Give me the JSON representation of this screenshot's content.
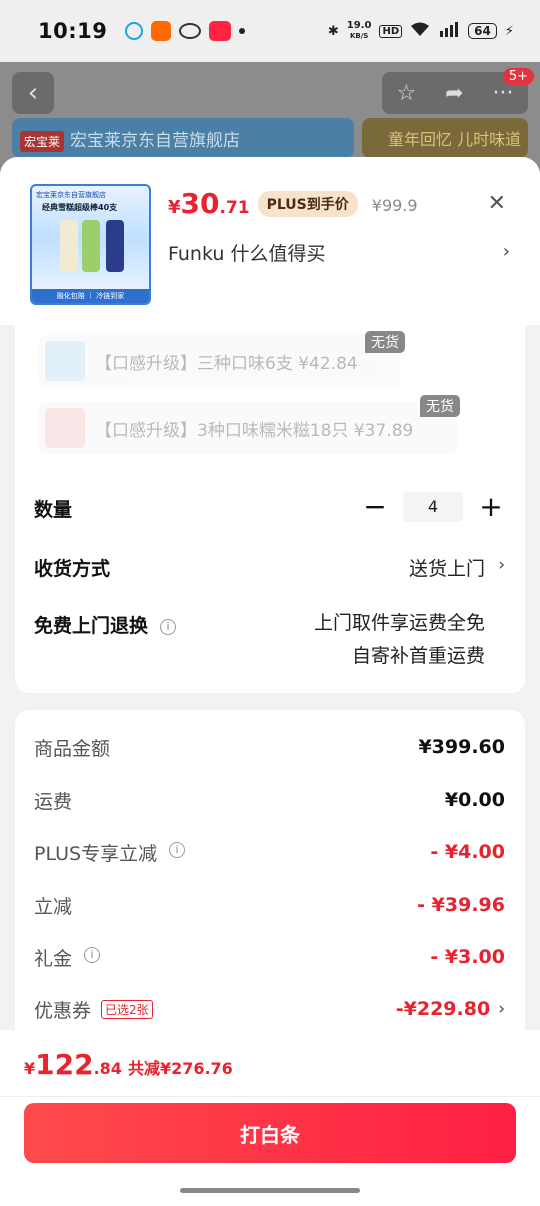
{
  "status_bar": {
    "time": "10:19",
    "net_speed_value": "19.0",
    "net_speed_unit": "KB/S",
    "hd_label": "HD",
    "battery": "64"
  },
  "background_page": {
    "shop_banner": "宏宝莱京东自营旗舰店",
    "shop_logo": "宏宝莱",
    "promo_banner": "童年回忆 儿时味道",
    "badge": "5+"
  },
  "product": {
    "price_symbol": "¥",
    "price_int": "30",
    "price_dec": ".71",
    "plus_tag": "PLUS到手价",
    "orig_price": "¥99.9",
    "shop_line": "Funku  什么值得买",
    "thumb_top": "宏宝莱京东自营旗舰店",
    "thumb_title": "经典雪糕超级棒40支",
    "thumb_bar": "融化包赔 ｜ 冷链到家"
  },
  "options": [
    {
      "text": "【口感升级】三种口味6支  ¥42.84",
      "badge": "无货"
    },
    {
      "text": "【口感升级】3种口味糯米糍18只  ¥37.89",
      "badge": "无货"
    }
  ],
  "rows": {
    "quantity_label": "数量",
    "quantity_value": "4",
    "delivery_label": "收货方式",
    "delivery_value": "送货上门",
    "return_label": "免费上门退换",
    "return_line1": "上门取件享运费全免",
    "return_line2": "自寄补首重运费"
  },
  "summary": [
    {
      "label": "商品金额",
      "value": "¥399.60",
      "red": false,
      "info": false
    },
    {
      "label": "运费",
      "value": "¥0.00",
      "red": false,
      "info": false
    },
    {
      "label": "PLUS专享立减",
      "value": "- ¥4.00",
      "red": true,
      "info": true
    },
    {
      "label": "立减",
      "value": "- ¥39.96",
      "red": true,
      "info": false
    },
    {
      "label": "礼金",
      "value": "- ¥3.00",
      "red": true,
      "info": true
    },
    {
      "label": "优惠券",
      "value": "-¥229.80",
      "red": true,
      "info": false,
      "tag": "已选2张"
    }
  ],
  "footer": {
    "total_symbol": "¥",
    "total_int": "122",
    "total_dec": ".84",
    "total_saved": "共减¥276.76",
    "pay_label": "打白条"
  },
  "colors": {
    "accent_red": "#e8222e",
    "plus_tag_bg": "#f7e2cc"
  }
}
